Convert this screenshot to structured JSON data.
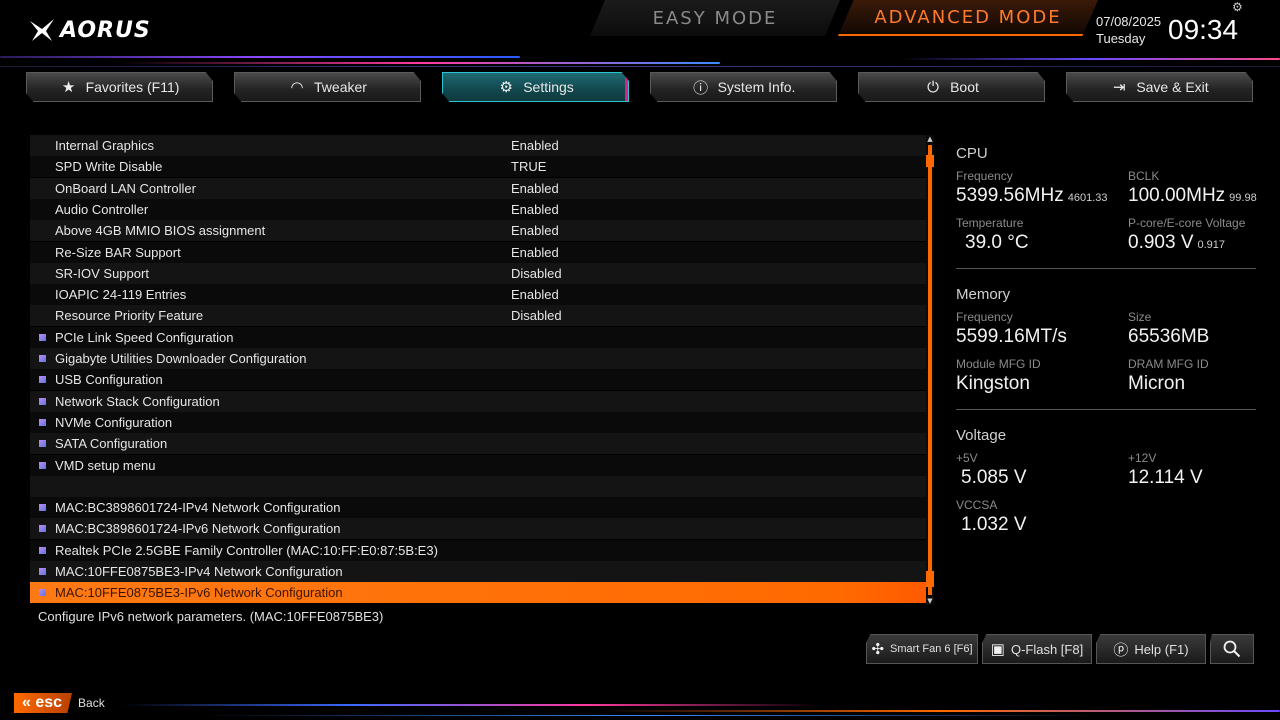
{
  "brand": {
    "logo_text": "AORUS"
  },
  "modes": {
    "easy": "EASY MODE",
    "advanced": "ADVANCED MODE"
  },
  "clock": {
    "date": "07/08/2025",
    "day": "Tuesday",
    "time": "09:34"
  },
  "colors": {
    "accent": "#ff6a00",
    "active_tab": "#1f6a72",
    "active_tab_border": "#2bc4d0"
  },
  "nav": {
    "tabs": [
      {
        "label": "Favorites (F11)",
        "icon": "star-icon"
      },
      {
        "label": "Tweaker",
        "icon": "speedometer-icon"
      },
      {
        "label": "Settings",
        "icon": "gear-icon",
        "active": true
      },
      {
        "label": "System Info.",
        "icon": "info-icon"
      },
      {
        "label": "Boot",
        "icon": "power-icon"
      },
      {
        "label": "Save & Exit",
        "icon": "exit-icon"
      }
    ]
  },
  "settings": {
    "rows": [
      {
        "label": "Internal Graphics",
        "value": "Enabled"
      },
      {
        "label": "SPD Write Disable",
        "value": "TRUE"
      },
      {
        "label": "OnBoard LAN Controller",
        "value": "Enabled"
      },
      {
        "label": "Audio Controller",
        "value": "Enabled"
      },
      {
        "label": "Above 4GB MMIO BIOS assignment",
        "value": "Enabled"
      },
      {
        "label": "Re-Size BAR Support",
        "value": "Enabled"
      },
      {
        "label": "SR-IOV Support",
        "value": "Disabled"
      },
      {
        "label": "IOAPIC 24-119 Entries",
        "value": "Enabled"
      },
      {
        "label": "Resource Priority Feature",
        "value": "Disabled"
      },
      {
        "label": "PCIe Link Speed Configuration",
        "submenu": true
      },
      {
        "label": "Gigabyte Utilities Downloader Configuration",
        "submenu": true
      },
      {
        "label": "USB Configuration",
        "submenu": true
      },
      {
        "label": "Network Stack Configuration",
        "submenu": true
      },
      {
        "label": "NVMe Configuration",
        "submenu": true
      },
      {
        "label": "SATA Configuration",
        "submenu": true
      },
      {
        "label": "VMD setup menu",
        "submenu": true
      },
      {
        "label": "",
        "blank": true
      },
      {
        "label": "MAC:BC3898601724-IPv4 Network Configuration",
        "submenu": true
      },
      {
        "label": "MAC:BC3898601724-IPv6 Network Configuration",
        "submenu": true
      },
      {
        "label": "Realtek PCIe 2.5GBE Family Controller (MAC:10:FF:E0:87:5B:E3)",
        "submenu": true
      },
      {
        "label": "MAC:10FFE0875BE3-IPv4 Network Configuration",
        "submenu": true
      },
      {
        "label": "MAC:10FFE0875BE3-IPv6 Network Configuration",
        "submenu": true,
        "selected": true
      }
    ],
    "help_text": "Configure IPv6 network parameters. (MAC:10FFE0875BE3)"
  },
  "cpu": {
    "title": "CPU",
    "frequency_label": "Frequency",
    "frequency": "5399.56MHz",
    "frequency_sub": "4601.33",
    "bclk_label": "BCLK",
    "bclk": "100.00MHz",
    "bclk_sub": "99.98",
    "temp_label": "Temperature",
    "temp": "39.0 °C",
    "voltage_label": "P-core/E-core Voltage",
    "voltage": "0.903 V",
    "voltage_sub": "0.917"
  },
  "memory": {
    "title": "Memory",
    "frequency_label": "Frequency",
    "frequency": "5599.16MT/s",
    "size_label": "Size",
    "size": "65536MB",
    "module_label": "Module MFG ID",
    "module": "Kingston",
    "dram_label": "DRAM MFG ID",
    "dram": "Micron"
  },
  "voltage": {
    "title": "Voltage",
    "v5_label": "+5V",
    "v5": "5.085 V",
    "v12_label": "+12V",
    "v12": "12.114 V",
    "vccsa_label": "VCCSA",
    "vccsa": "1.032 V"
  },
  "bottom": {
    "smartfan": "Smart Fan 6 [F6]",
    "qflash": "Q-Flash [F8]",
    "help": "Help (F1)",
    "esc": "esc",
    "back": "Back"
  }
}
